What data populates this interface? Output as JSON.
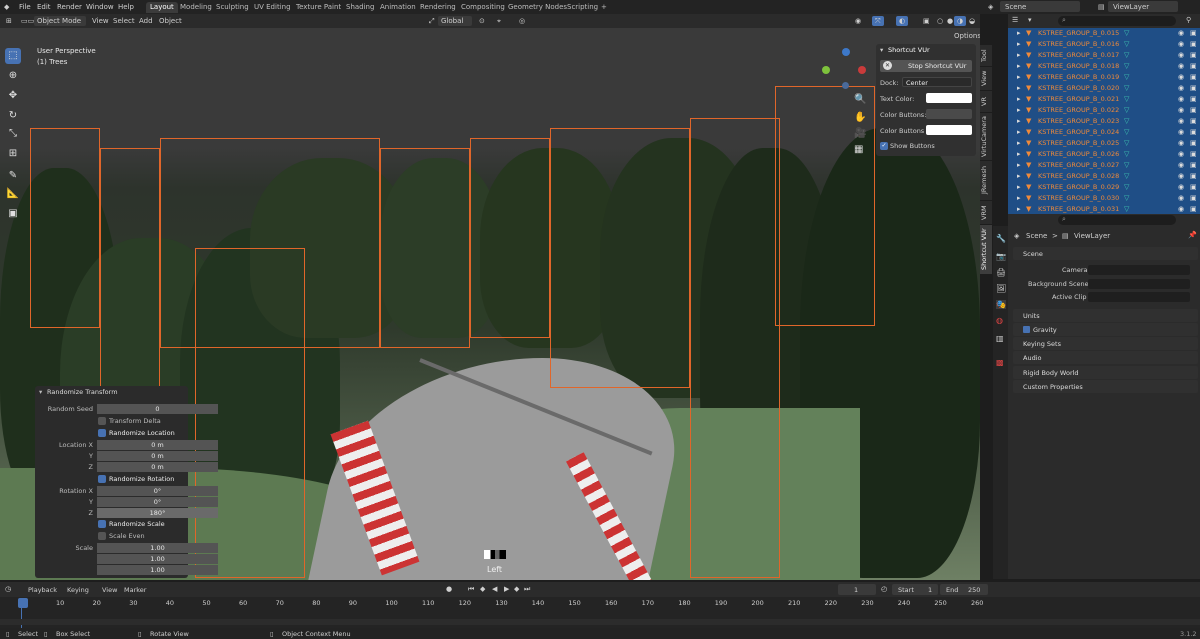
{
  "menu": {
    "items": [
      "File",
      "Edit",
      "Render",
      "Window",
      "Help"
    ],
    "workspaces": [
      "Layout",
      "Modeling",
      "Sculpting",
      "UV Editing",
      "Texture Paint",
      "Shading",
      "Animation",
      "Rendering",
      "Compositing",
      "Geometry Nodes",
      "Scripting"
    ],
    "add_tab": "+",
    "scene": "Scene",
    "view_layer": "ViewLayer"
  },
  "viewport_header": {
    "mode": "Object Mode",
    "view": "View",
    "select": "Select",
    "add": "Add",
    "object": "Object",
    "orientation": "Global",
    "options": "Options"
  },
  "viewport": {
    "perspective": "User Perspective",
    "collection": "(1) Trees",
    "view_label": "Left"
  },
  "side_tabs": [
    "Tool",
    "View",
    "VR",
    "VirtuCamera",
    "JRemesh",
    "VRM",
    "Shortcut VUr"
  ],
  "shortcut_panel": {
    "title": "Shortcut VUr",
    "stop_button": "Stop Shortcut VUr",
    "dock_label": "Dock:",
    "dock_value": "Center",
    "text_color": "Text Color:",
    "color_buttons": "Color Buttons:",
    "color_buttons_2": "Color Buttons ...",
    "show_buttons": "Show Buttons"
  },
  "randomize": {
    "title": "Randomize Transform",
    "seed_label": "Random Seed",
    "seed_value": "0",
    "transform_delta": "Transform Delta",
    "randomize_location": "Randomize Location",
    "location_x_label": "Location X",
    "y_label": "Y",
    "z_label": "Z",
    "loc_x": "0 m",
    "loc_y": "0 m",
    "loc_z": "0 m",
    "randomize_rotation": "Randomize Rotation",
    "rotation_x_label": "Rotation X",
    "rot_x": "0°",
    "rot_y": "0°",
    "rot_z": "180°",
    "randomize_scale": "Randomize Scale",
    "scale_even": "Scale Even",
    "scale_label": "Scale",
    "scale_x": "1.00",
    "scale_y": "1.00",
    "scale_z": "1.00"
  },
  "outliner": {
    "rows": [
      "KSTREE_GROUP_B_0.015",
      "KSTREE_GROUP_B_0.016",
      "KSTREE_GROUP_B_0.017",
      "KSTREE_GROUP_B_0.018",
      "KSTREE_GROUP_B_0.019",
      "KSTREE_GROUP_B_0.020",
      "KSTREE_GROUP_B_0.021",
      "KSTREE_GROUP_B_0.022",
      "KSTREE_GROUP_B_0.023",
      "KSTREE_GROUP_B_0.024",
      "KSTREE_GROUP_B_0.025",
      "KSTREE_GROUP_B_0.026",
      "KSTREE_GROUP_B_0.027",
      "KSTREE_GROUP_B_0.028",
      "KSTREE_GROUP_B_0.029",
      "KSTREE_GROUP_B_0.030",
      "KSTREE_GROUP_B_0.031"
    ]
  },
  "properties": {
    "breadcrumb_scene": "Scene",
    "breadcrumb_sep": ">",
    "breadcrumb_layer": "ViewLayer",
    "scene_section": "Scene",
    "camera_label": "Camera",
    "background_label": "Background Scene",
    "active_clip_label": "Active Clip",
    "sections": [
      "Units",
      "Gravity",
      "Keying Sets",
      "Audio",
      "Rigid Body World",
      "Custom Properties"
    ]
  },
  "timeline": {
    "playback": "Playback",
    "keying": "Keying",
    "view": "View",
    "marker": "Marker",
    "current_frame": "1",
    "start_label": "Start",
    "start_value": "1",
    "end_label": "End",
    "end_value": "250",
    "ticks": [
      "1",
      "10",
      "20",
      "30",
      "40",
      "50",
      "60",
      "70",
      "80",
      "90",
      "100",
      "110",
      "120",
      "130",
      "140",
      "150",
      "160",
      "170",
      "180",
      "190",
      "200",
      "210",
      "220",
      "230",
      "240",
      "250",
      "260"
    ]
  },
  "status": {
    "select": "Select",
    "box_select": "Box Select",
    "rotate_view": "Rotate View",
    "context_menu": "Object Context Menu",
    "version": "3.1.2"
  },
  "colors": {
    "accent": "#4772b3",
    "outliner_bg": "#1f4e86",
    "selection": "#e0662a"
  }
}
